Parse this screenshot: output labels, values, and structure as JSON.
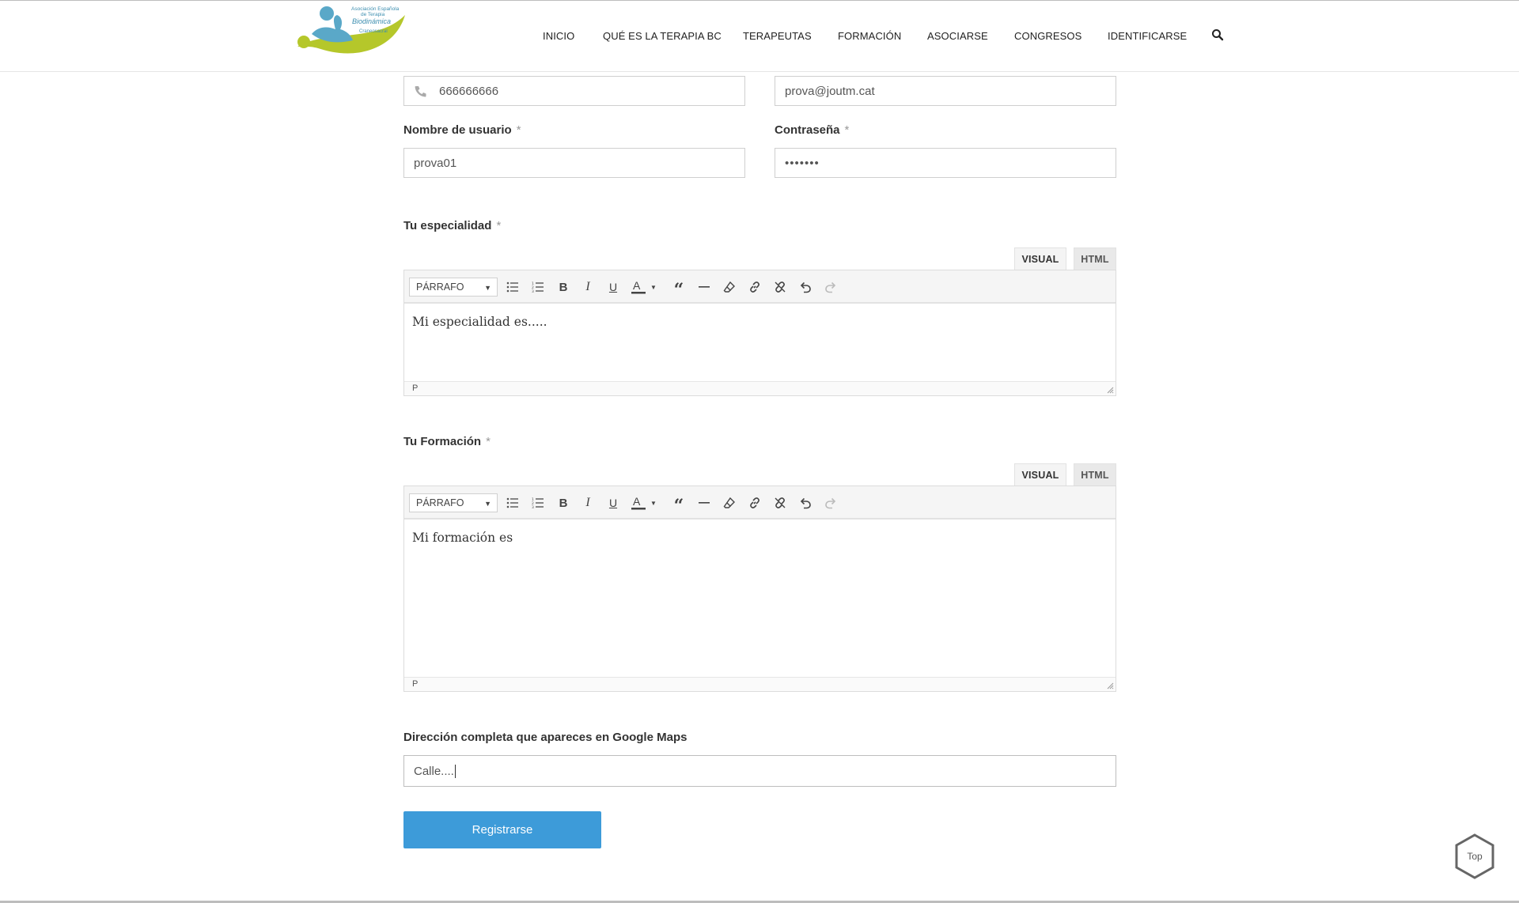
{
  "header": {
    "logo_text": [
      "Asociación Española",
      "de Terapia",
      "Biodinámica",
      "Craneosacral"
    ],
    "nav": [
      {
        "label": "INICIO"
      },
      {
        "label": "QUÉ ES LA TERAPIA BC"
      },
      {
        "label": "TERAPEUTAS"
      },
      {
        "label": "FORMACIÓN"
      },
      {
        "label": "ASOCIARSE"
      },
      {
        "label": "CONGRESOS"
      },
      {
        "label": "IDENTIFICARSE"
      }
    ],
    "search_icon": "search-icon"
  },
  "form": {
    "phone": {
      "value": "666666666",
      "icon": "phone-icon"
    },
    "email": {
      "value": "prova@joutm.cat"
    },
    "username": {
      "label": "Nombre de usuario",
      "required": "*",
      "value": "prova01"
    },
    "password": {
      "label": "Contraseña",
      "required": "*",
      "value": "•••••••"
    },
    "especialidad": {
      "label": "Tu especialidad",
      "required": "*",
      "tab_visual": "VISUAL",
      "tab_html": "HTML",
      "format": "PÁRRAFO",
      "content": "Mi especialidad es.....",
      "status": "P"
    },
    "formacion": {
      "label": "Tu Formación",
      "required": "*",
      "tab_visual": "VISUAL",
      "tab_html": "HTML",
      "format": "PÁRRAFO",
      "content": "Mi formación es",
      "status": "P"
    },
    "direccion": {
      "label": "Dirección completa que apareces en Google Maps",
      "value": "Calle...."
    },
    "submit_label": "Registrarse"
  },
  "top_button": {
    "label": "Top"
  },
  "colors": {
    "accent": "#3d9bd9",
    "logo_blue": "#5aa8c8",
    "logo_green": "#b5c72a"
  }
}
